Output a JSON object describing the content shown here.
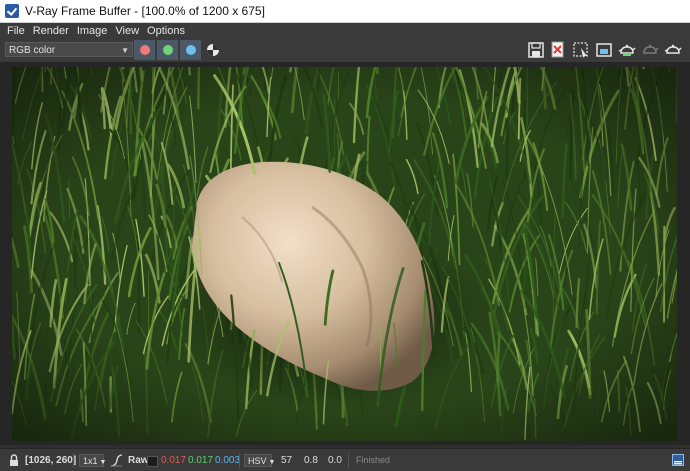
{
  "window": {
    "title": "V-Ray Frame Buffer - [100.0% of 1200 x 675]"
  },
  "menu": [
    "File",
    "Render",
    "Image",
    "View",
    "Options"
  ],
  "toolbar": {
    "channel": "RGB color",
    "channel_buttons": [
      {
        "name": "red",
        "color": "#f07a7a"
      },
      {
        "name": "green",
        "color": "#6fd37a"
      },
      {
        "name": "blue",
        "color": "#6fbff0"
      }
    ],
    "icons": [
      "save-image-icon",
      "clear-image-icon",
      "region-render-icon",
      "track-mouse-icon",
      "render-icon",
      "interactive-render-icon",
      "teapot-icon"
    ]
  },
  "render": {
    "colors": {
      "grass_dark": "#1a2c12",
      "grass_mid": "#3d6a22",
      "grass_light": "#8fb055",
      "rock": "#d8c2a6"
    }
  },
  "status": {
    "coords": "[1026, 260]",
    "zoom": "1x1",
    "mode": "Raw",
    "r": "0.017",
    "g": "0.017",
    "b": "0.003",
    "colorspace": "HSV",
    "h": "57",
    "s": "0.8",
    "v": "0.0",
    "state": "Finished"
  }
}
